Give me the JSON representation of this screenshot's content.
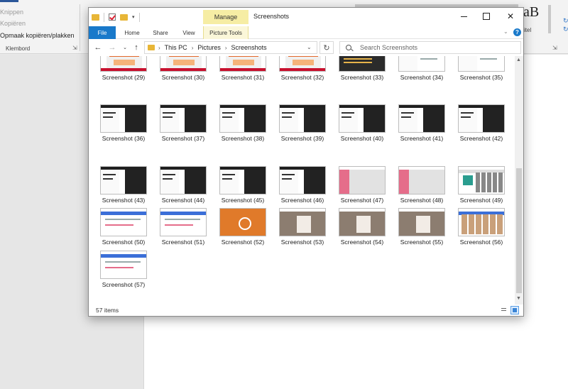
{
  "background_app": {
    "clipboard_items": [
      "Knippen",
      "Kopiëren",
      "Opmaak kopiëren/plakken"
    ],
    "clipboard_group_label": "Klembord",
    "styles_preview": "aB",
    "styles_label": "itel"
  },
  "explorer": {
    "title": "Screenshots",
    "contextual_tab_header": "Manage",
    "tabs": [
      {
        "label": "File"
      },
      {
        "label": "Home"
      },
      {
        "label": "Share"
      },
      {
        "label": "View"
      },
      {
        "label": "Picture Tools"
      }
    ],
    "address": {
      "crumbs": [
        "This PC",
        "Pictures",
        "Screenshots"
      ]
    },
    "search": {
      "placeholder": "Search Screenshots"
    },
    "status": {
      "item_count": "57 items"
    },
    "files": [
      {
        "label": "Screenshot (29)",
        "thumb": "orange"
      },
      {
        "label": "Screenshot (30)",
        "thumb": "orange"
      },
      {
        "label": "Screenshot (31)",
        "thumb": "orange"
      },
      {
        "label": "Screenshot (32)",
        "thumb": "orange"
      },
      {
        "label": "Screenshot (33)",
        "thumb": "code"
      },
      {
        "label": "Screenshot (34)",
        "thumb": "doc"
      },
      {
        "label": "Screenshot (35)",
        "thumb": "doc"
      },
      {
        "label": "Screenshot (36)",
        "thumb": "split"
      },
      {
        "label": "Screenshot (37)",
        "thumb": "split"
      },
      {
        "label": "Screenshot (38)",
        "thumb": "split"
      },
      {
        "label": "Screenshot (39)",
        "thumb": "split"
      },
      {
        "label": "Screenshot (40)",
        "thumb": "split"
      },
      {
        "label": "Screenshot (41)",
        "thumb": "split"
      },
      {
        "label": "Screenshot (42)",
        "thumb": "split"
      },
      {
        "label": "Screenshot (43)",
        "thumb": "split"
      },
      {
        "label": "Screenshot (44)",
        "thumb": "split"
      },
      {
        "label": "Screenshot (45)",
        "thumb": "split"
      },
      {
        "label": "Screenshot (46)",
        "thumb": "split"
      },
      {
        "label": "Screenshot (47)",
        "thumb": "pink"
      },
      {
        "label": "Screenshot (48)",
        "thumb": "pink"
      },
      {
        "label": "Screenshot (49)",
        "thumb": "green"
      },
      {
        "label": "Screenshot (50)",
        "thumb": "web"
      },
      {
        "label": "Screenshot (51)",
        "thumb": "web"
      },
      {
        "label": "Screenshot (52)",
        "thumb": "circle"
      },
      {
        "label": "Screenshot (53)",
        "thumb": "photo"
      },
      {
        "label": "Screenshot (54)",
        "thumb": "photo"
      },
      {
        "label": "Screenshot (55)",
        "thumb": "photo"
      },
      {
        "label": "Screenshot (56)",
        "thumb": "grid"
      },
      {
        "label": "Screenshot (57)",
        "thumb": "web"
      }
    ]
  },
  "colors": {
    "file_tab": "#1979ca",
    "picture_tools": "#f6eda4",
    "folder": "#e8b637"
  },
  "icons": [
    "folder-icon",
    "properties-check-icon",
    "back-arrow-icon",
    "forward-arrow-icon",
    "up-arrow-icon",
    "refresh-icon",
    "search-icon",
    "minimize-icon",
    "maximize-icon",
    "close-icon",
    "help-icon",
    "details-view-icon",
    "large-icons-view-icon"
  ]
}
